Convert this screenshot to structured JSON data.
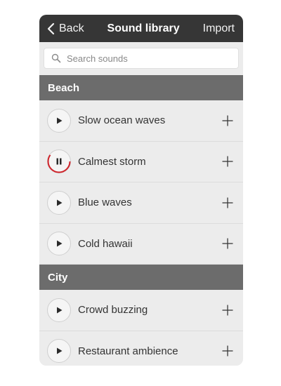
{
  "navbar": {
    "back_label": "Back",
    "title": "Sound library",
    "import_label": "Import"
  },
  "search": {
    "placeholder": "Search sounds",
    "value": ""
  },
  "sections": [
    {
      "title": "Beach",
      "items": [
        {
          "label": "Slow ocean waves",
          "state": "play"
        },
        {
          "label": "Calmest storm",
          "state": "pause",
          "progress": 0.6
        },
        {
          "label": "Blue waves",
          "state": "play"
        },
        {
          "label": "Cold hawaii",
          "state": "play"
        }
      ]
    },
    {
      "title": "City",
      "items": [
        {
          "label": "Crowd buzzing",
          "state": "play"
        },
        {
          "label": "Restaurant ambience",
          "state": "play"
        }
      ]
    }
  ],
  "colors": {
    "navbar_bg": "#363636",
    "section_bg": "#6c6c6c",
    "row_bg": "#ececec",
    "progress_accent": "#d0232a"
  },
  "icons": {
    "back": "chevron-left-icon",
    "search": "magnifier-icon",
    "play": "play-icon",
    "pause": "pause-icon",
    "add": "plus-icon"
  }
}
